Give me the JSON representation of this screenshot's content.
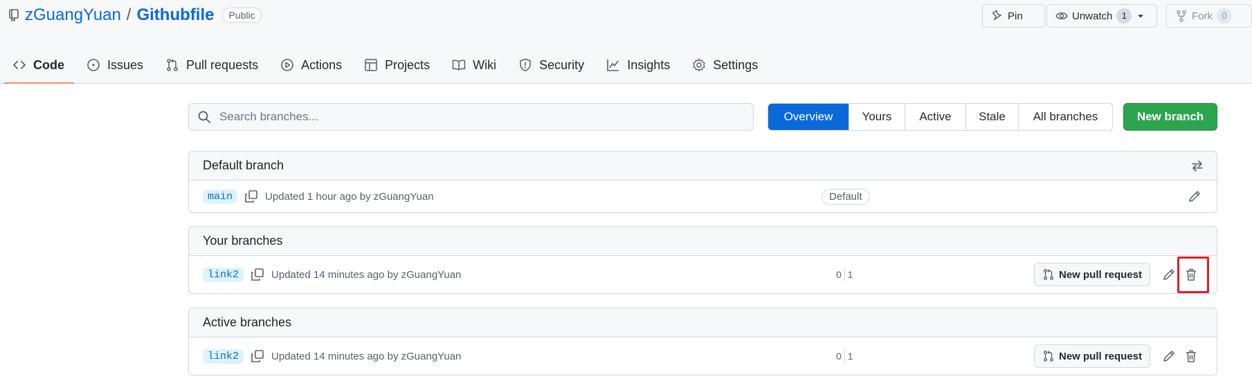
{
  "repo": {
    "owner": "zGuangYuan",
    "separator": "/",
    "name": "Githubfile",
    "visibility": "Public"
  },
  "header_actions": {
    "pin_label": "Pin",
    "unwatch_label": "Unwatch",
    "unwatch_count": "1",
    "fork_label": "Fork",
    "fork_count": "0"
  },
  "tabs": [
    {
      "label": "Code",
      "icon": "code-icon",
      "active": true
    },
    {
      "label": "Issues",
      "icon": "issue-icon"
    },
    {
      "label": "Pull requests",
      "icon": "pull-request-icon"
    },
    {
      "label": "Actions",
      "icon": "play-icon"
    },
    {
      "label": "Projects",
      "icon": "table-icon"
    },
    {
      "label": "Wiki",
      "icon": "book-icon"
    },
    {
      "label": "Security",
      "icon": "shield-icon"
    },
    {
      "label": "Insights",
      "icon": "graph-icon"
    },
    {
      "label": "Settings",
      "icon": "gear-icon"
    }
  ],
  "search": {
    "placeholder": "Search branches..."
  },
  "filters": {
    "overview": "Overview",
    "yours": "Yours",
    "active": "Active",
    "stale": "Stale",
    "all": "All branches"
  },
  "new_branch_label": "New branch",
  "sections": {
    "default": {
      "title": "Default branch",
      "branch": "main",
      "updated": "Updated 1 hour ago by zGuangYuan",
      "badge": "Default"
    },
    "yours": {
      "title": "Your branches",
      "branch": "link2",
      "updated": "Updated 14 minutes ago by zGuangYuan",
      "behind": "0",
      "ahead": "1",
      "pr_label": "New pull request"
    },
    "active": {
      "title": "Active branches",
      "branch": "link2",
      "updated": "Updated 14 minutes ago by zGuangYuan",
      "behind": "0",
      "ahead": "1",
      "pr_label": "New pull request"
    }
  },
  "colors": {
    "accent": "#0969da",
    "primary_button": "#2da44e",
    "tab_underline": "#fd8c73",
    "highlight": "#e11d2a"
  }
}
